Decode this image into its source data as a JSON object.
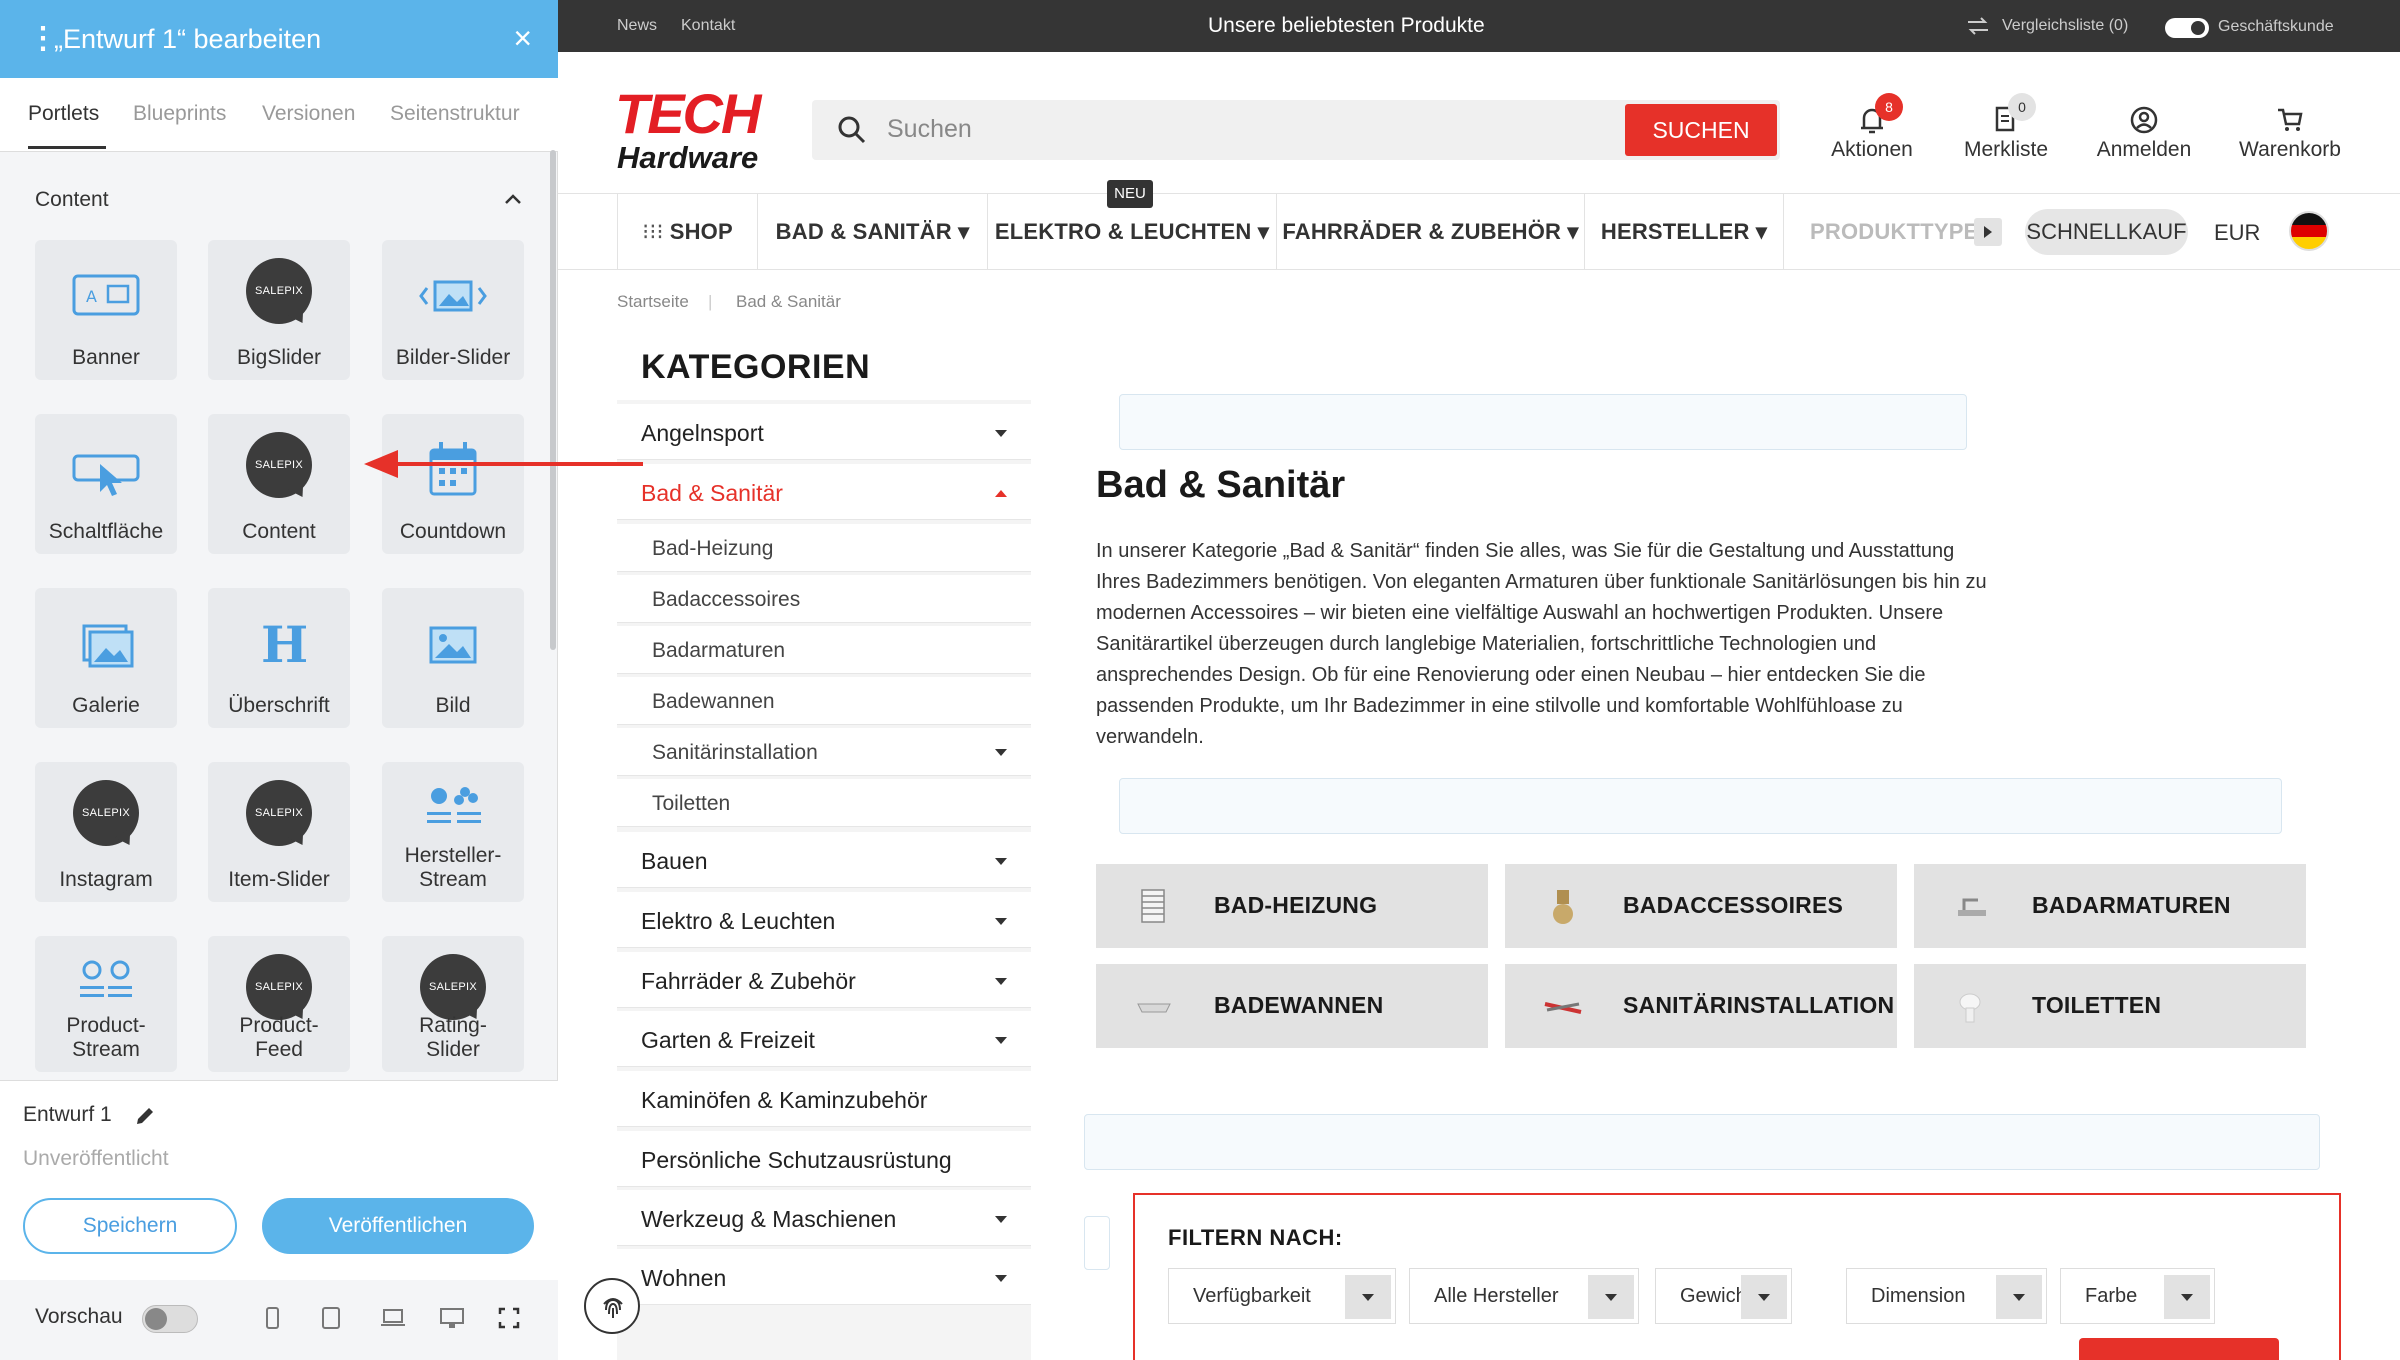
{
  "editor": {
    "title": "„Entwurf 1“ bearbeiten",
    "close_label": "×",
    "tabs": [
      "Portlets",
      "Blueprints",
      "Versionen",
      "Seitenstruktur"
    ],
    "section_label": "Content",
    "portlets": [
      "Banner",
      "BigSlider",
      "Bilder-Slider",
      "Schaltfläche",
      "Content",
      "Countdown",
      "Galerie",
      "Überschrift",
      "Bild",
      "Instagram",
      "Item-Slider",
      "Hersteller-Stream",
      "Product-Stream",
      "Product-Feed",
      "Rating-Slider"
    ],
    "salepix_text": "SALEPIX",
    "draft_name": "Entwurf 1",
    "draft_state": "Unveröffentlicht",
    "save_label": "Speichern",
    "publish_label": "Veröffentlichen",
    "preview_label": "Vorschau",
    "accent_color": "#5bb4ea"
  },
  "topbar": {
    "news": "News",
    "contact": "Kontakt",
    "promo": "Unsere beliebtesten Produkte",
    "compare": "Vergleichsliste (0)",
    "business": "Geschäftskunde"
  },
  "header": {
    "logo_line1": "TECH",
    "logo_line2": "Hardware",
    "search_placeholder": "Suchen",
    "search_button": "SUCHEN",
    "actions_label": "Aktionen",
    "actions_count": "8",
    "wishlist_label": "Merkliste",
    "wishlist_count": "0",
    "login_label": "Anmelden",
    "cart_label": "Warenkorb",
    "brand_color": "#e63129"
  },
  "nav": {
    "shop": "SHOP",
    "items": [
      "BAD & SANITÄR",
      "ELEKTRO & LEUCHTEN",
      "FAHRRÄDER & ZUBEHÖR",
      "HERSTELLER"
    ],
    "new_badge": "NEU",
    "product_types": "PRODUKTTYPEN",
    "quickbuy": "SCHNELLKAUF",
    "currency": "EUR"
  },
  "breadcrumb": [
    "Startseite",
    "Bad & Sanitär"
  ],
  "categories": {
    "title": "KATEGORIEN",
    "items": [
      "Angelnsport",
      "Bad & Sanitär",
      "Bauen",
      "Elektro & Leuchten",
      "Fahrräder & Zubehör",
      "Garten & Freizeit",
      "Kaminöfen & Kaminzubehör",
      "Persönliche Schutzausrüstung",
      "Werkzeug & Maschienen",
      "Wohnen"
    ],
    "sub_items": [
      "Bad-Heizung",
      "Badaccessoires",
      "Badarmaturen",
      "Badewannen",
      "Sanitärinstallation",
      "Toiletten"
    ]
  },
  "main": {
    "heading": "Bad & Sanitär",
    "description": "In unserer Kategorie „Bad & Sanitär“ finden Sie alles, was Sie für die Gestaltung und Ausstattung Ihres Badezimmers benötigen. Von eleganten Armaturen über funktionale Sanitärlösungen bis hin zu modernen Accessoires – wir bieten eine vielfältige Auswahl an hochwertigen Produkten. Unsere Sanitärartikel überzeugen durch langlebige Materialien, fortschrittliche Technologien und ansprechendes Design. Ob für eine Renovierung oder einen Neubau – hier entdecken Sie die passenden Produkte, um Ihr Badezimmer in eine stilvolle und komfortable Wohlfühloase zu verwandeln.",
    "tiles": [
      "BAD-HEIZUNG",
      "BADACCESSOIRES",
      "BADARMATUREN",
      "BADEWANNEN",
      "SANITÄRINSTALLATION",
      "TOILETTEN"
    ]
  },
  "filter": {
    "title": "FILTERN NACH:",
    "options": [
      "Verfügbarkeit",
      "Alle Hersteller",
      "Gewicht",
      "Dimension",
      "Farbe"
    ]
  }
}
